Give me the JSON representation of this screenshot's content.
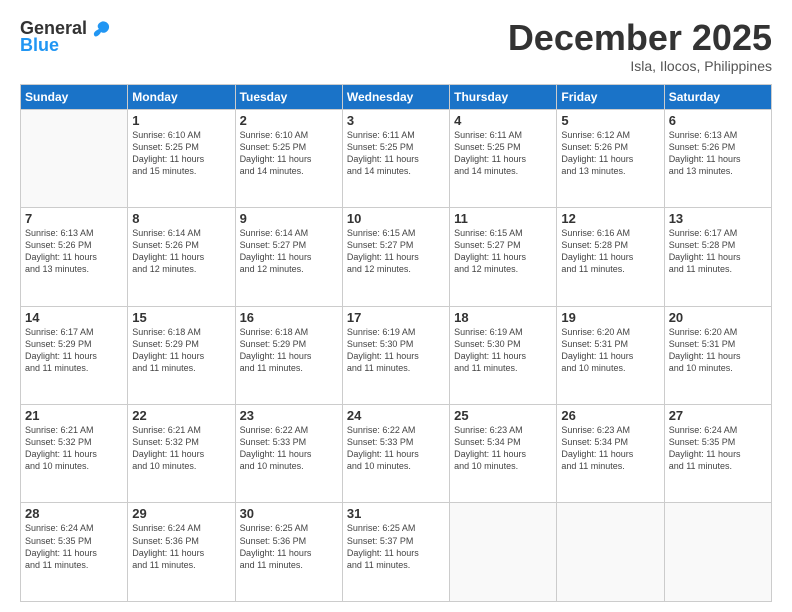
{
  "header": {
    "logo_general": "General",
    "logo_blue": "Blue",
    "month_title": "December 2025",
    "subtitle": "Isla, Ilocos, Philippines"
  },
  "days_of_week": [
    "Sunday",
    "Monday",
    "Tuesday",
    "Wednesday",
    "Thursday",
    "Friday",
    "Saturday"
  ],
  "weeks": [
    [
      {
        "day": "",
        "info": ""
      },
      {
        "day": "1",
        "info": "Sunrise: 6:10 AM\nSunset: 5:25 PM\nDaylight: 11 hours\nand 15 minutes."
      },
      {
        "day": "2",
        "info": "Sunrise: 6:10 AM\nSunset: 5:25 PM\nDaylight: 11 hours\nand 14 minutes."
      },
      {
        "day": "3",
        "info": "Sunrise: 6:11 AM\nSunset: 5:25 PM\nDaylight: 11 hours\nand 14 minutes."
      },
      {
        "day": "4",
        "info": "Sunrise: 6:11 AM\nSunset: 5:25 PM\nDaylight: 11 hours\nand 14 minutes."
      },
      {
        "day": "5",
        "info": "Sunrise: 6:12 AM\nSunset: 5:26 PM\nDaylight: 11 hours\nand 13 minutes."
      },
      {
        "day": "6",
        "info": "Sunrise: 6:13 AM\nSunset: 5:26 PM\nDaylight: 11 hours\nand 13 minutes."
      }
    ],
    [
      {
        "day": "7",
        "info": "Sunrise: 6:13 AM\nSunset: 5:26 PM\nDaylight: 11 hours\nand 13 minutes."
      },
      {
        "day": "8",
        "info": "Sunrise: 6:14 AM\nSunset: 5:26 PM\nDaylight: 11 hours\nand 12 minutes."
      },
      {
        "day": "9",
        "info": "Sunrise: 6:14 AM\nSunset: 5:27 PM\nDaylight: 11 hours\nand 12 minutes."
      },
      {
        "day": "10",
        "info": "Sunrise: 6:15 AM\nSunset: 5:27 PM\nDaylight: 11 hours\nand 12 minutes."
      },
      {
        "day": "11",
        "info": "Sunrise: 6:15 AM\nSunset: 5:27 PM\nDaylight: 11 hours\nand 12 minutes."
      },
      {
        "day": "12",
        "info": "Sunrise: 6:16 AM\nSunset: 5:28 PM\nDaylight: 11 hours\nand 11 minutes."
      },
      {
        "day": "13",
        "info": "Sunrise: 6:17 AM\nSunset: 5:28 PM\nDaylight: 11 hours\nand 11 minutes."
      }
    ],
    [
      {
        "day": "14",
        "info": "Sunrise: 6:17 AM\nSunset: 5:29 PM\nDaylight: 11 hours\nand 11 minutes."
      },
      {
        "day": "15",
        "info": "Sunrise: 6:18 AM\nSunset: 5:29 PM\nDaylight: 11 hours\nand 11 minutes."
      },
      {
        "day": "16",
        "info": "Sunrise: 6:18 AM\nSunset: 5:29 PM\nDaylight: 11 hours\nand 11 minutes."
      },
      {
        "day": "17",
        "info": "Sunrise: 6:19 AM\nSunset: 5:30 PM\nDaylight: 11 hours\nand 11 minutes."
      },
      {
        "day": "18",
        "info": "Sunrise: 6:19 AM\nSunset: 5:30 PM\nDaylight: 11 hours\nand 11 minutes."
      },
      {
        "day": "19",
        "info": "Sunrise: 6:20 AM\nSunset: 5:31 PM\nDaylight: 11 hours\nand 10 minutes."
      },
      {
        "day": "20",
        "info": "Sunrise: 6:20 AM\nSunset: 5:31 PM\nDaylight: 11 hours\nand 10 minutes."
      }
    ],
    [
      {
        "day": "21",
        "info": "Sunrise: 6:21 AM\nSunset: 5:32 PM\nDaylight: 11 hours\nand 10 minutes."
      },
      {
        "day": "22",
        "info": "Sunrise: 6:21 AM\nSunset: 5:32 PM\nDaylight: 11 hours\nand 10 minutes."
      },
      {
        "day": "23",
        "info": "Sunrise: 6:22 AM\nSunset: 5:33 PM\nDaylight: 11 hours\nand 10 minutes."
      },
      {
        "day": "24",
        "info": "Sunrise: 6:22 AM\nSunset: 5:33 PM\nDaylight: 11 hours\nand 10 minutes."
      },
      {
        "day": "25",
        "info": "Sunrise: 6:23 AM\nSunset: 5:34 PM\nDaylight: 11 hours\nand 10 minutes."
      },
      {
        "day": "26",
        "info": "Sunrise: 6:23 AM\nSunset: 5:34 PM\nDaylight: 11 hours\nand 11 minutes."
      },
      {
        "day": "27",
        "info": "Sunrise: 6:24 AM\nSunset: 5:35 PM\nDaylight: 11 hours\nand 11 minutes."
      }
    ],
    [
      {
        "day": "28",
        "info": "Sunrise: 6:24 AM\nSunset: 5:35 PM\nDaylight: 11 hours\nand 11 minutes."
      },
      {
        "day": "29",
        "info": "Sunrise: 6:24 AM\nSunset: 5:36 PM\nDaylight: 11 hours\nand 11 minutes."
      },
      {
        "day": "30",
        "info": "Sunrise: 6:25 AM\nSunset: 5:36 PM\nDaylight: 11 hours\nand 11 minutes."
      },
      {
        "day": "31",
        "info": "Sunrise: 6:25 AM\nSunset: 5:37 PM\nDaylight: 11 hours\nand 11 minutes."
      },
      {
        "day": "",
        "info": ""
      },
      {
        "day": "",
        "info": ""
      },
      {
        "day": "",
        "info": ""
      }
    ]
  ]
}
